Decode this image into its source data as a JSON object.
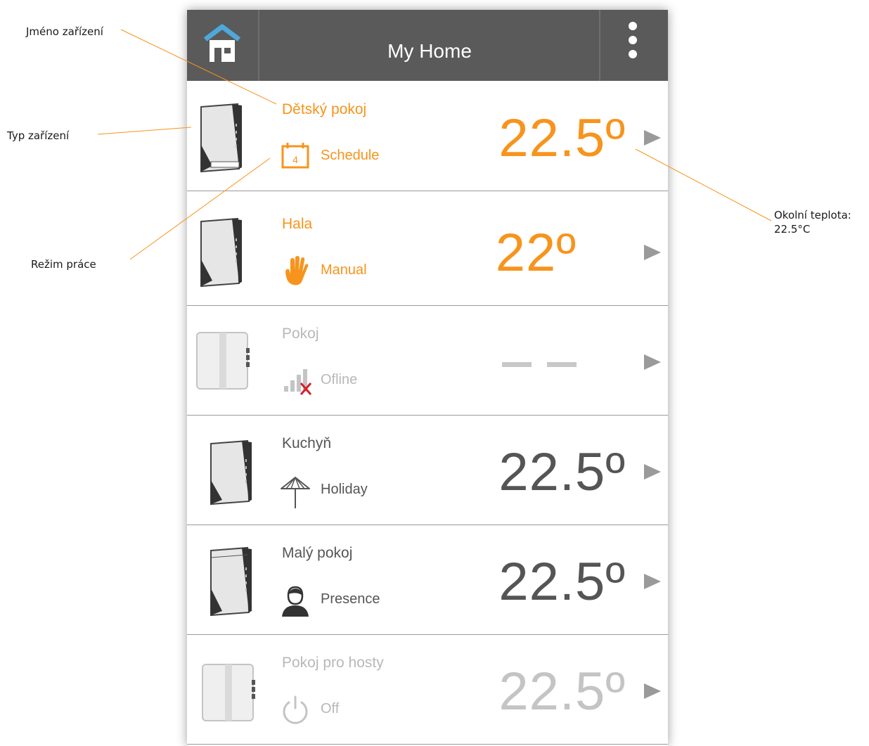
{
  "annotations": {
    "device_name": "Jméno zařízení",
    "device_type": "Typ zařízení",
    "work_mode": "Režim práce",
    "ambient_temp": "Okolní teplota: 22.5°C"
  },
  "header": {
    "title": "My Home",
    "home_icon": "home-icon",
    "menu_icon": "kebab-menu-icon"
  },
  "colors": {
    "accent": "#F7941D",
    "active_text": "#555555",
    "inactive_text": "#B8B8B8",
    "topbar": "#5A5A5A",
    "home_roof": "#4FA8DA",
    "offline_x": "#D6202A"
  },
  "rooms": [
    {
      "name": "Dětský pokoj",
      "mode": "Schedule",
      "mode_icon": "calendar-icon",
      "calendar_day": "4",
      "temperature": "22.5º",
      "device": "thermostat-dark",
      "state": "accent"
    },
    {
      "name": "Hala",
      "mode": "Manual",
      "mode_icon": "hand-icon",
      "temperature": "22º",
      "device": "thermostat-dark",
      "state": "accent"
    },
    {
      "name": "Pokoj",
      "mode": "Ofline",
      "mode_icon": "signal-offline-icon",
      "temperature": "",
      "device": "thermostat-light",
      "state": "inactive"
    },
    {
      "name": "Kuchyň",
      "mode": "Holiday",
      "mode_icon": "umbrella-icon",
      "temperature": "22.5º",
      "device": "thermostat-dark",
      "state": "active"
    },
    {
      "name": "Malý pokoj",
      "mode": "Presence",
      "mode_icon": "person-icon",
      "temperature": "22.5º",
      "device": "thermostat-dark",
      "state": "active"
    },
    {
      "name": "Pokoj pro hosty",
      "mode": "Off",
      "mode_icon": "power-icon",
      "temperature": "22.5º",
      "device": "thermostat-light",
      "state": "inactive"
    }
  ]
}
